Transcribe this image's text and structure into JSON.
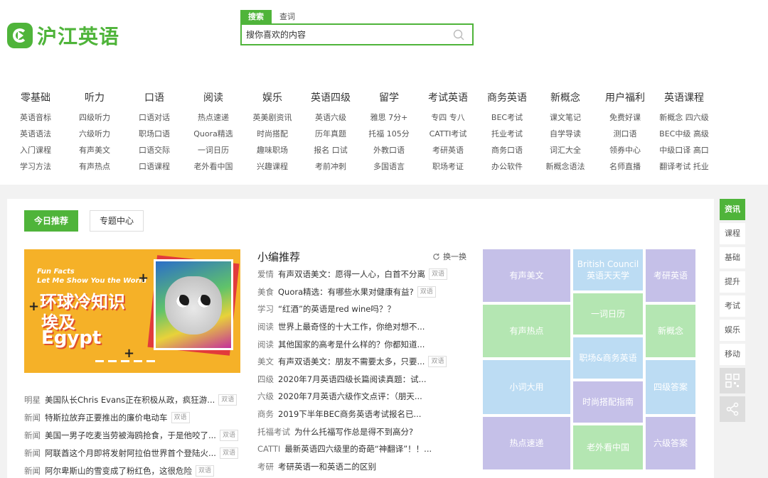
{
  "brand": {
    "name": "沪江英语"
  },
  "search": {
    "tabs": [
      "搜索",
      "查词"
    ],
    "placeholder": "搜你喜欢的内容"
  },
  "nav": [
    {
      "title": "零基础",
      "items": [
        "英语音标",
        "英语语法",
        "入门课程",
        "学习方法"
      ]
    },
    {
      "title": "听力",
      "items": [
        "四级听力",
        "六级听力",
        "有声美文",
        "有声热点"
      ]
    },
    {
      "title": "口语",
      "items": [
        "口语对话",
        "职场口语",
        "口语交际",
        "口语课程"
      ]
    },
    {
      "title": "阅读",
      "items": [
        "热点速递",
        "Quora精选",
        "一词日历",
        "老外看中国"
      ]
    },
    {
      "title": "娱乐",
      "items": [
        "英美剧资讯",
        "时尚搭配",
        "趣味职场",
        "兴趣课程"
      ]
    },
    {
      "title": "英语四级",
      "items": [
        "英语六级",
        "历年真题",
        "报名 口试",
        "考前冲刺"
      ]
    },
    {
      "title": "留学",
      "items": [
        "雅思 7分+",
        "托福 105分",
        "外教口语",
        "多国语言"
      ]
    },
    {
      "title": "考试英语",
      "items": [
        "专四 专八",
        "CATTI考试",
        "考研英语",
        "职场考证"
      ]
    },
    {
      "title": "商务英语",
      "items": [
        "BEC考试",
        "托业考试",
        "商务口语",
        "办公软件"
      ]
    },
    {
      "title": "新概念",
      "items": [
        "课文笔记",
        "自学导读",
        "词汇大全",
        "新概念语法"
      ]
    },
    {
      "title": "用户福利",
      "items": [
        "免费好课",
        "测口语",
        "领券中心",
        "名师直播"
      ]
    },
    {
      "title": "英语课程",
      "items": [
        "新概念 四六级",
        "BEC中级 高级",
        "中级口译 高口",
        "翻译考试 托业"
      ]
    }
  ],
  "main": {
    "tabs": [
      "今日推荐",
      "专题中心"
    ],
    "banner": {
      "fun_facts": "Fun Facts",
      "tagline": "Let Me Show You the World",
      "title": "环球冷知识",
      "subtitle_cn": "埃及",
      "subtitle_en": "Egypt"
    },
    "left_list": [
      {
        "cat": "明星",
        "title": "美国队长Chris Evans正在积极从政，疯狂游...",
        "tag": "双语"
      },
      {
        "cat": "新闻",
        "title": "特斯拉放弃正要推出的廉价电动车",
        "tag": "双语"
      },
      {
        "cat": "新闻",
        "title": "美国一男子吃麦当劳被海鸥抢食，于是他咬了...",
        "tag": "双语"
      },
      {
        "cat": "新闻",
        "title": "阿联酋这个月即将发射阿拉伯世界首个登陆火...",
        "tag": "双语"
      },
      {
        "cat": "新闻",
        "title": "阿尔卑斯山的雪变成了粉红色，这很危险",
        "tag": "双语"
      }
    ],
    "recommend": {
      "title": "小编推荐",
      "change": "换一换",
      "items": [
        {
          "cat": "爱情",
          "title": "有声双语美文：愿得一人心，白首不分离",
          "tag": "双语"
        },
        {
          "cat": "美食",
          "title": "Quora精选：有哪些水果对健康有益?",
          "tag": "双语"
        },
        {
          "cat": "学习",
          "title": "“红酒”的英语是red wine吗？？",
          "tag": ""
        },
        {
          "cat": "阅读",
          "title": "世界上最奇怪的十大工作，你绝对想不...",
          "tag": ""
        },
        {
          "cat": "阅读",
          "title": "其他国家的高考是什么样的？你都知道...",
          "tag": ""
        },
        {
          "cat": "美文",
          "title": "有声双语美文：朋友不需要太多，只要...",
          "tag": "双语"
        },
        {
          "cat": "四级",
          "title": "2020年7月英语四级长篇阅读真题：试...",
          "tag": ""
        },
        {
          "cat": "六级",
          "title": "2020年7月英语六级作文点评：（朋天...",
          "tag": ""
        },
        {
          "cat": "商务",
          "title": "2019下半年BEC商务英语考试报名已...",
          "tag": ""
        },
        {
          "cat": "托福考试",
          "title": "为什么托福写作总是得不到高分?",
          "tag": ""
        },
        {
          "cat": "CATTI",
          "title": "最新英语四六级里的奇葩“神翻译”！！...",
          "tag": ""
        },
        {
          "cat": "考研",
          "title": "考研英语一和英语二的区别",
          "tag": ""
        }
      ]
    },
    "tiles": [
      {
        "label": "有声美文",
        "color": "#c5c0e8"
      },
      {
        "label": "British Council\n英语天天学",
        "color": "#bcdcf3"
      },
      {
        "label": "考研英语",
        "color": "#c5c0e8"
      },
      {
        "label": "一词日历",
        "color": "#b4e6b2"
      },
      {
        "label": "有声热点",
        "color": "#b4e6b2"
      },
      {
        "label": "新概念",
        "color": "#b4e6b2"
      },
      {
        "label": "职场&商务英语",
        "color": "#bcdcf3"
      },
      {
        "label": "小词大用",
        "color": "#bcdcf3"
      },
      {
        "label": "四级答案",
        "color": "#bcdcf3"
      },
      {
        "label": "时尚搭配指南",
        "color": "#c5c0e8"
      },
      {
        "label": "热点速递",
        "color": "#c5c0e8"
      },
      {
        "label": "老外看中国",
        "color": "#b4e6b2"
      },
      {
        "label": "六级答案",
        "color": "#c5c0e8"
      }
    ]
  },
  "rail": [
    "资讯",
    "课程",
    "基础",
    "提升",
    "考试",
    "娱乐",
    "移动"
  ],
  "colors": {
    "accent": "#4fb43a"
  }
}
